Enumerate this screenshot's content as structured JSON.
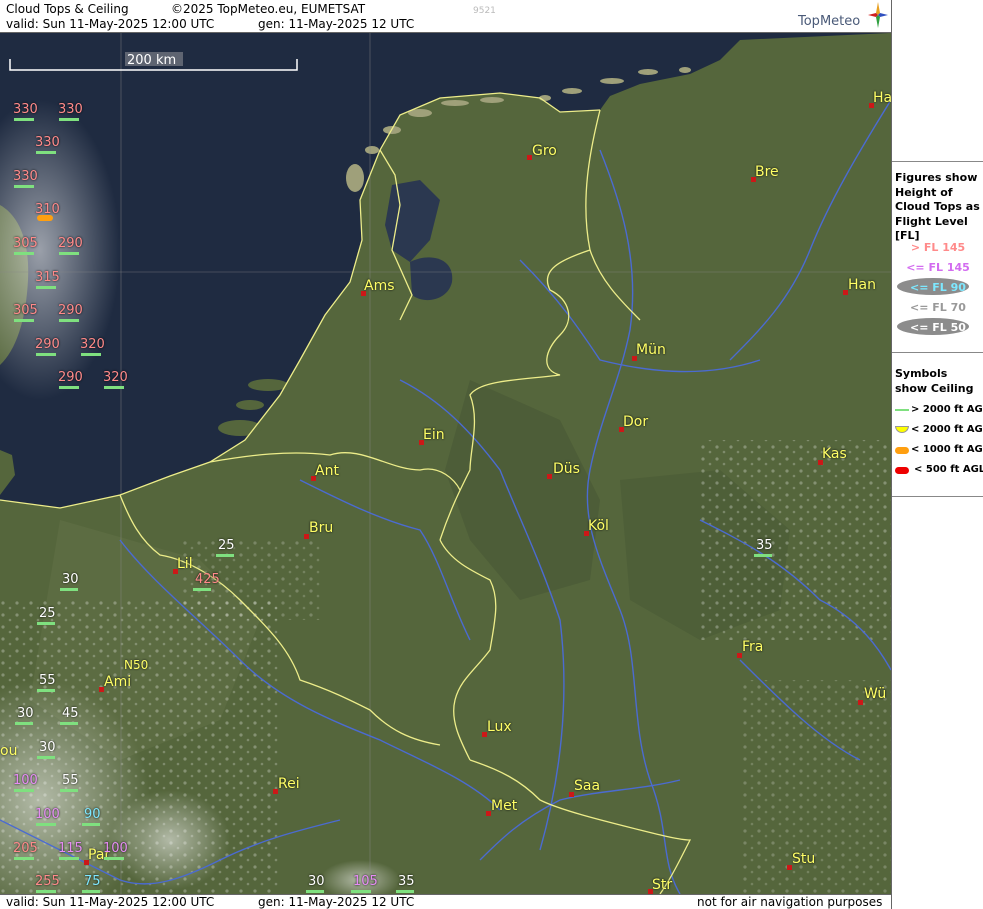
{
  "header": {
    "title": "Cloud Tops & Ceiling",
    "copyright": "©2025 TopMeteo.eu, EUMETSAT",
    "valid": "valid:  Sun  11-May-2025  12:00 UTC",
    "generated": "gen: 11-May-2025 12 UTC",
    "image_number": "9521",
    "logo": "TopMeteo"
  },
  "footer": {
    "valid": "valid:  Sun  11-May-2025  12:00 UTC",
    "generated": "gen: 11-May-2025 12 UTC",
    "note": "not for air navigation purposes"
  },
  "scale_bar": {
    "label": "200 km"
  },
  "legend": {
    "figures_title": "Figures show Height of Cloud Tops as Flight Level  [FL]",
    "levels": [
      {
        "label": "> FL 145",
        "color": "#ff8a8a",
        "oval": false
      },
      {
        "label": "<= FL 145",
        "color": "#d36cf0",
        "oval": false
      },
      {
        "label": "<= FL 90",
        "color": "#7de8ff",
        "oval": true
      },
      {
        "label": "<= FL 70",
        "color": "#999999",
        "oval": false
      },
      {
        "label": "<= FL 50",
        "color": "#ffffff",
        "oval": true
      }
    ],
    "symbols_title": "Symbols show Ceiling",
    "ceilings": [
      {
        "label": "> 2000 ft AGL",
        "color": "#7fe07f",
        "shape": "line"
      },
      {
        "label": "< 2000 ft AGL",
        "color": "#ffff00",
        "shape": "half"
      },
      {
        "label": "< 1000 ft AGL",
        "color": "#ff9f10",
        "shape": "pill"
      },
      {
        "label": "< 500 ft AGL",
        "color": "#ee0000",
        "shape": "pill"
      }
    ]
  },
  "cities": [
    "Gro",
    "Bre",
    "Ha",
    "Ams",
    "Han",
    "Mün",
    "Dor",
    "Ein",
    "Ant",
    "Düs",
    "Kas",
    "Bru",
    "Köl",
    "Lil",
    "Ami",
    "N50",
    "Fra",
    "Wü",
    "Lux",
    "Rei",
    "Saa",
    "Met",
    "Par",
    "Stu",
    "Str",
    "ou"
  ],
  "flight_levels": [
    {
      "text": "330",
      "tier": "hi"
    },
    {
      "text": "330",
      "tier": "hi"
    },
    {
      "text": "330",
      "tier": "hi"
    },
    {
      "text": "330",
      "tier": "hi"
    },
    {
      "text": "310",
      "tier": "hi"
    },
    {
      "text": "305",
      "tier": "hi"
    },
    {
      "text": "290",
      "tier": "hi"
    },
    {
      "text": "315",
      "tier": "hi"
    },
    {
      "text": "305",
      "tier": "hi"
    },
    {
      "text": "290",
      "tier": "hi"
    },
    {
      "text": "290",
      "tier": "hi"
    },
    {
      "text": "320",
      "tier": "hi"
    },
    {
      "text": "290",
      "tier": "hi"
    },
    {
      "text": "320",
      "tier": "hi"
    },
    {
      "text": "25",
      "tier": "w"
    },
    {
      "text": "425",
      "tier": "hi"
    },
    {
      "text": "30",
      "tier": "w"
    },
    {
      "text": "25",
      "tier": "w"
    },
    {
      "text": "35",
      "tier": "w"
    },
    {
      "text": "55",
      "tier": "w"
    },
    {
      "text": "30",
      "tier": "w"
    },
    {
      "text": "45",
      "tier": "w"
    },
    {
      "text": "30",
      "tier": "w"
    },
    {
      "text": "100",
      "tier": "mid"
    },
    {
      "text": "55",
      "tier": "w"
    },
    {
      "text": "100",
      "tier": "mid"
    },
    {
      "text": "90",
      "tier": "low"
    },
    {
      "text": "205",
      "tier": "hi"
    },
    {
      "text": "115",
      "tier": "mid"
    },
    {
      "text": "100",
      "tier": "mid"
    },
    {
      "text": "255",
      "tier": "hi"
    },
    {
      "text": "75",
      "tier": "low"
    },
    {
      "text": "30",
      "tier": "w"
    },
    {
      "text": "105",
      "tier": "mid"
    },
    {
      "text": "35",
      "tier": "w"
    }
  ]
}
